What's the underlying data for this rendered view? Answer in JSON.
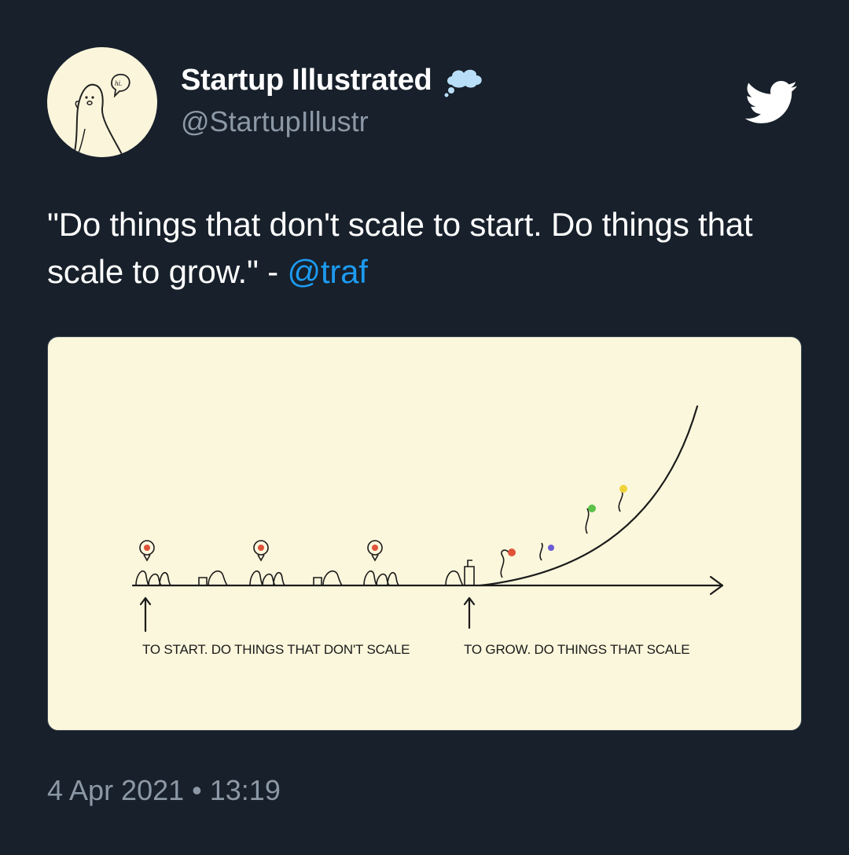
{
  "author": {
    "display_name": "Startup Illustrated",
    "handle": "@StartupIllustr",
    "avatar_speech": "hi.",
    "badge_icon": "thought-cloud-icon"
  },
  "brand": {
    "logo_icon": "twitter-bird-icon",
    "mention_color": "#1d9bf0"
  },
  "tweet": {
    "text_before": "\"Do things that don't scale to start. Do things that scale to grow.\" - ",
    "mention": "@traf"
  },
  "media": {
    "label_start": "TO START. DO THINGS THAT DON'T SCALE",
    "label_grow": "TO GROW. DO THINGS THAT SCALE"
  },
  "meta": {
    "date": "4 Apr 2021",
    "separator": "•",
    "time": "13:19"
  }
}
